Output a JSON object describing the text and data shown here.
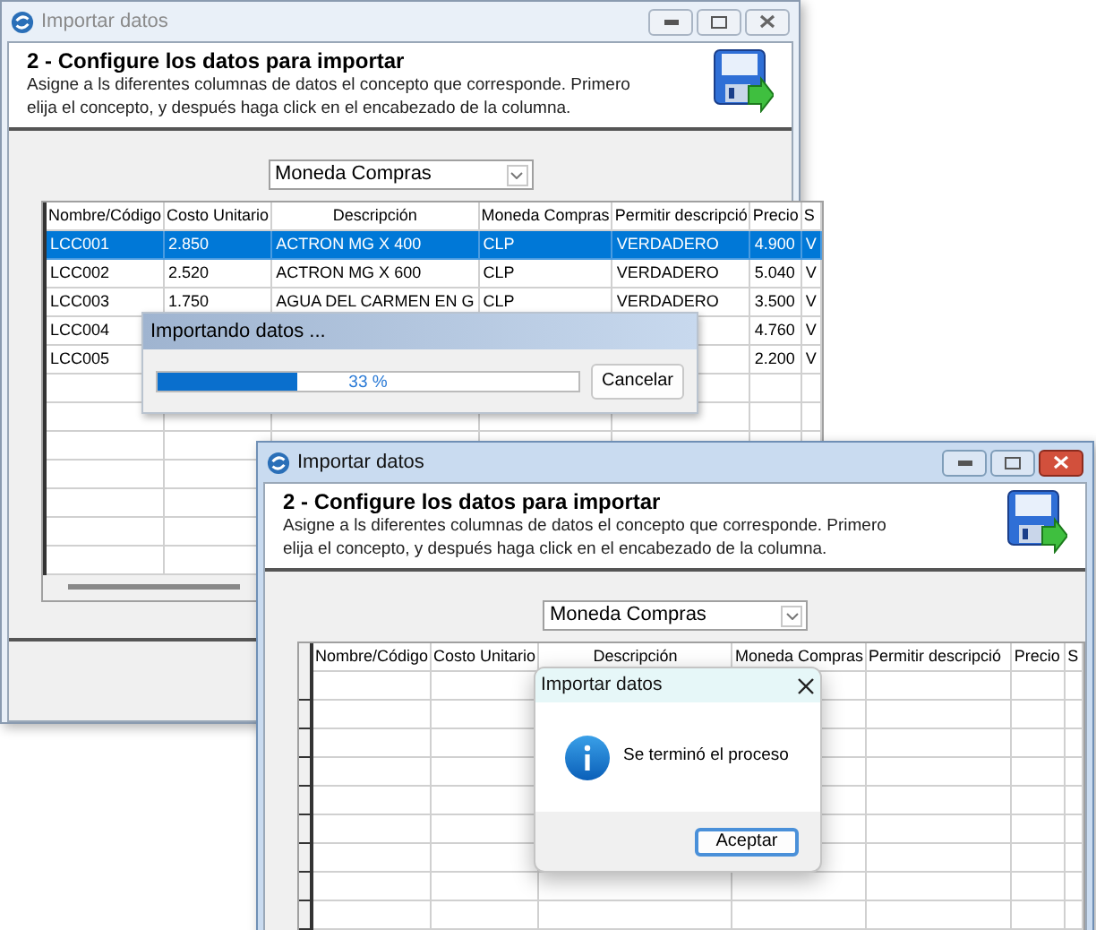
{
  "windows": [
    {
      "title": "Importar datos",
      "active": false,
      "heading": "2 - Configure los datos para importar",
      "instructions": [
        "Asigne a ls diferentes columnas de datos el concepto que corresponde. Primero",
        "elija el concepto, y después haga click en el encabezado de la columna."
      ],
      "concept_select": {
        "value": "Moneda Compras"
      },
      "grid": {
        "columns": [
          "Nombre/Código",
          "Costo Unitario",
          "Descripción",
          "Moneda Compras",
          "Permitir descripció",
          "Precio",
          "S"
        ],
        "rows": [
          {
            "selected": true,
            "cells": [
              "LCC001",
              "2.850",
              "ACTRON MG X 400",
              "CLP",
              "VERDADERO",
              "4.900",
              "V"
            ]
          },
          {
            "selected": false,
            "cells": [
              "LCC002",
              "2.520",
              "ACTRON MG X 600",
              "CLP",
              "VERDADERO",
              "5.040",
              "V"
            ]
          },
          {
            "selected": false,
            "cells": [
              "LCC003",
              "1.750",
              "AGUA DEL CARMEN EN G",
              "CLP",
              "VERDADERO",
              "3.500",
              "V"
            ]
          },
          {
            "selected": false,
            "cells": [
              "LCC004",
              null,
              null,
              null,
              null,
              "4.760",
              "V"
            ]
          },
          {
            "selected": false,
            "cells": [
              "LCC005",
              null,
              null,
              null,
              null,
              "2.200",
              "V"
            ]
          }
        ]
      }
    },
    {
      "title": "Importar datos",
      "active": true,
      "heading": "2 - Configure los datos para importar",
      "instructions": [
        "Asigne a ls diferentes columnas de datos el concepto que corresponde. Primero",
        "elija el concepto, y después haga click en el encabezado de la columna."
      ],
      "concept_select": {
        "value": "Moneda Compras"
      },
      "grid": {
        "columns": [
          "Nombre/Código",
          "Costo Unitario",
          "Descripción",
          "Moneda Compras",
          "Permitir descripció",
          "Precio",
          "S"
        ]
      }
    }
  ],
  "progress_dialog": {
    "title": "Importando datos ...",
    "level": 0.33,
    "reading": "33 %",
    "cancel_button": "Cancelar"
  },
  "message_box": {
    "title": "Importar datos",
    "message": "Se terminó el proceso",
    "ok_button": "Aceptar"
  }
}
